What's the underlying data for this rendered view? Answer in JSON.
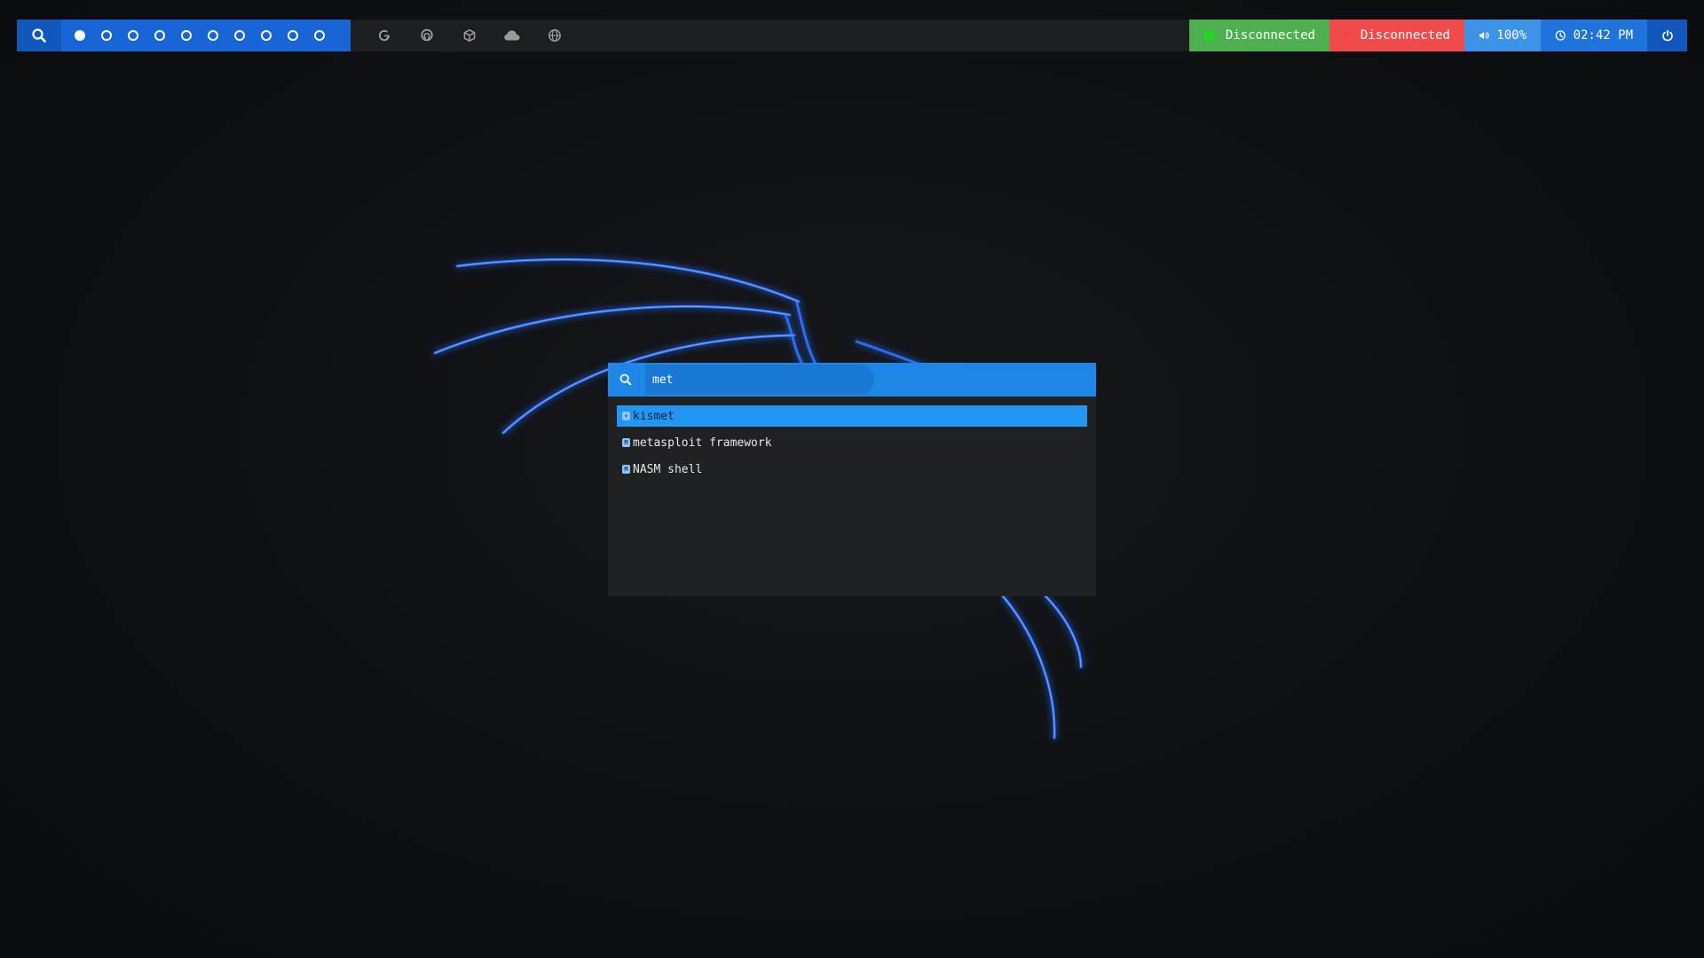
{
  "topbar": {
    "workspaces": [
      {
        "active": true
      },
      {
        "active": false
      },
      {
        "active": false
      },
      {
        "active": false
      },
      {
        "active": false
      },
      {
        "active": false
      },
      {
        "active": false
      },
      {
        "active": false
      },
      {
        "active": false
      },
      {
        "active": false
      }
    ],
    "launchers": [
      "google-icon",
      "github-icon",
      "package-icon",
      "cloud-icon",
      "globe-icon"
    ],
    "status": {
      "network_label": "Disconnected",
      "vpn_label": "Disconnected",
      "volume_label": "100%",
      "clock_label": "02:42 PM"
    },
    "colors": {
      "search": "#1257bd",
      "workspaces": "#1866d6",
      "network": "#4caf50",
      "vpn": "#f04a4a",
      "volume": "#3d93e8",
      "clock": "#1f74dc",
      "power": "#1257bd"
    }
  },
  "menu": {
    "query": "met",
    "results": [
      {
        "label": "kismet",
        "selected": true
      },
      {
        "label": "metasploit framework",
        "selected": false
      },
      {
        "label": "NASM shell",
        "selected": false
      }
    ]
  }
}
